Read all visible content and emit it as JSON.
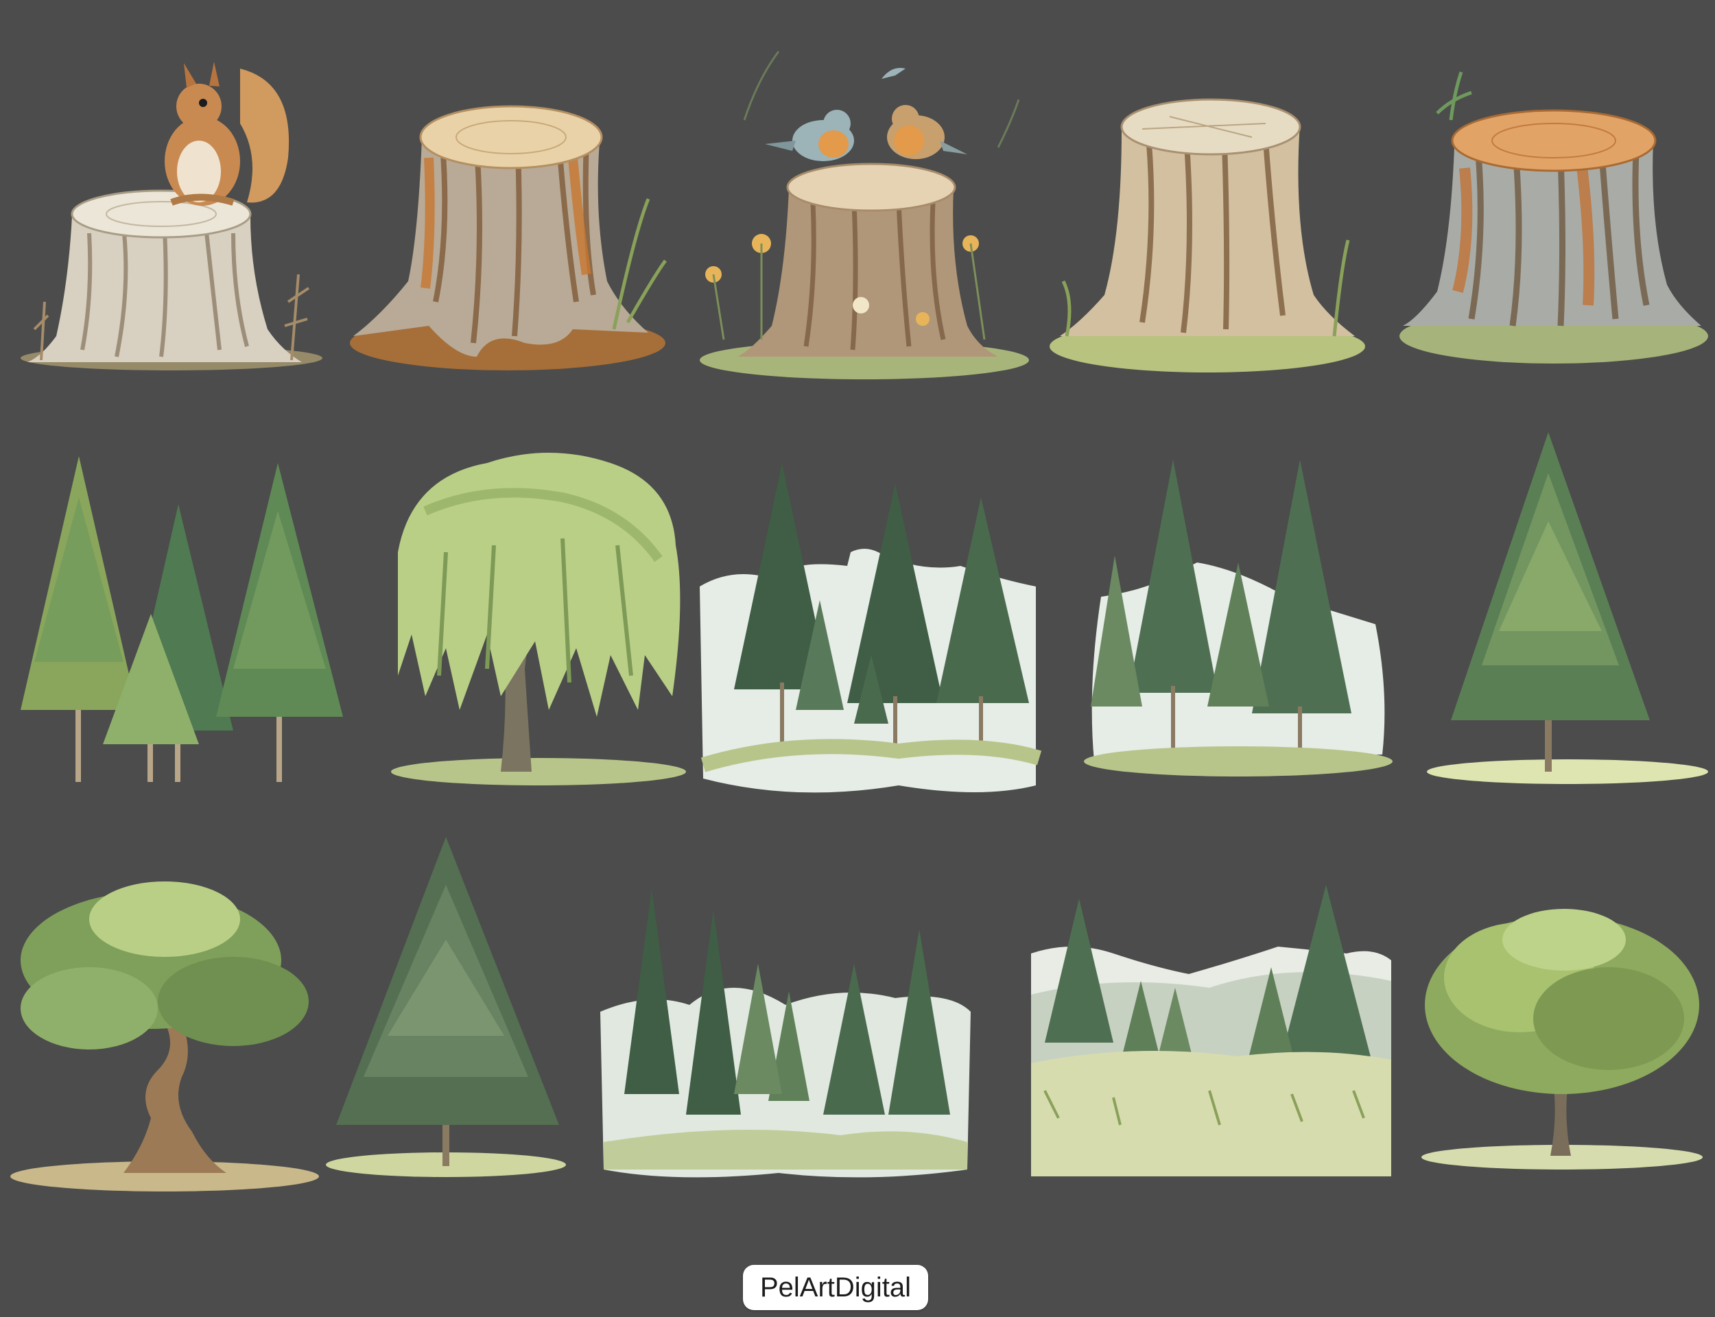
{
  "brand": {
    "watermark": "PelArtDigital"
  },
  "colors": {
    "background": "#4b4c4b",
    "bark_light": "#d8c9b0",
    "bark_dark": "#8a6a4a",
    "stump_top": "#e9d2a8",
    "rust": "#c77a3a",
    "grass": "#b8c58a",
    "pine_dark": "#3f5e45",
    "pine_light": "#6f9a5d",
    "leaf_light": "#b9cf86",
    "mist": "#e6ece6"
  },
  "rows": [
    {
      "name": "stumps",
      "items": [
        {
          "id": "stump-with-squirrel",
          "icon": "stump-squirrel-icon"
        },
        {
          "id": "rooted-stump",
          "icon": "stump-icon"
        },
        {
          "id": "stump-with-birds",
          "icon": "stump-birds-icon"
        },
        {
          "id": "pale-stump",
          "icon": "stump-icon"
        },
        {
          "id": "rusty-stump",
          "icon": "stump-icon"
        }
      ]
    },
    {
      "name": "trees",
      "items": [
        {
          "id": "three-firs",
          "icon": "fir-group-icon"
        },
        {
          "id": "weeping-willow",
          "icon": "willow-icon"
        },
        {
          "id": "misty-fir-grove",
          "icon": "fir-grove-icon"
        },
        {
          "id": "fir-grove",
          "icon": "fir-grove-icon"
        },
        {
          "id": "single-fir",
          "icon": "fir-icon"
        }
      ]
    },
    {
      "name": "landscapes",
      "items": [
        {
          "id": "twisted-oak",
          "icon": "oak-icon"
        },
        {
          "id": "spruce",
          "icon": "fir-icon"
        },
        {
          "id": "forest-edge",
          "icon": "forest-icon"
        },
        {
          "id": "mountain-meadow",
          "icon": "meadow-icon"
        },
        {
          "id": "round-tree",
          "icon": "round-tree-icon"
        }
      ]
    }
  ]
}
